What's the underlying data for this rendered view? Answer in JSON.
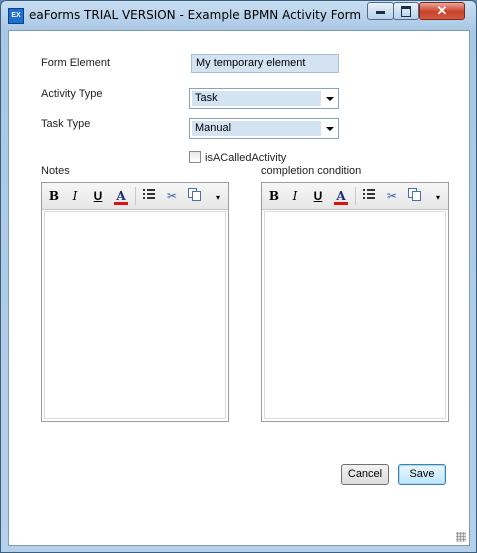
{
  "window": {
    "icon_label": "EX",
    "title": "eaForms TRIAL VERSION - Example BPMN Activity Form",
    "close_glyph": "✕"
  },
  "form": {
    "form_element_label": "Form Element",
    "form_element_value": "My temporary element",
    "activity_type_label": "Activity Type",
    "activity_type_value": "Task",
    "task_type_label": "Task Type",
    "task_type_value": "Manual",
    "checkbox_label": "isACalledActivity",
    "checkbox_checked": false
  },
  "editors": {
    "notes_label": "Notes",
    "completion_label": "completion condition",
    "toolbar": {
      "bold": "B",
      "italic": "I",
      "underline": "U",
      "font_color": "A",
      "cut": "✂",
      "more": "▾"
    }
  },
  "buttons": {
    "cancel": "Cancel",
    "save": "Save"
  },
  "colors": {
    "field_highlight": "#d3e3f2",
    "font_color_bar": "#dd1111"
  }
}
